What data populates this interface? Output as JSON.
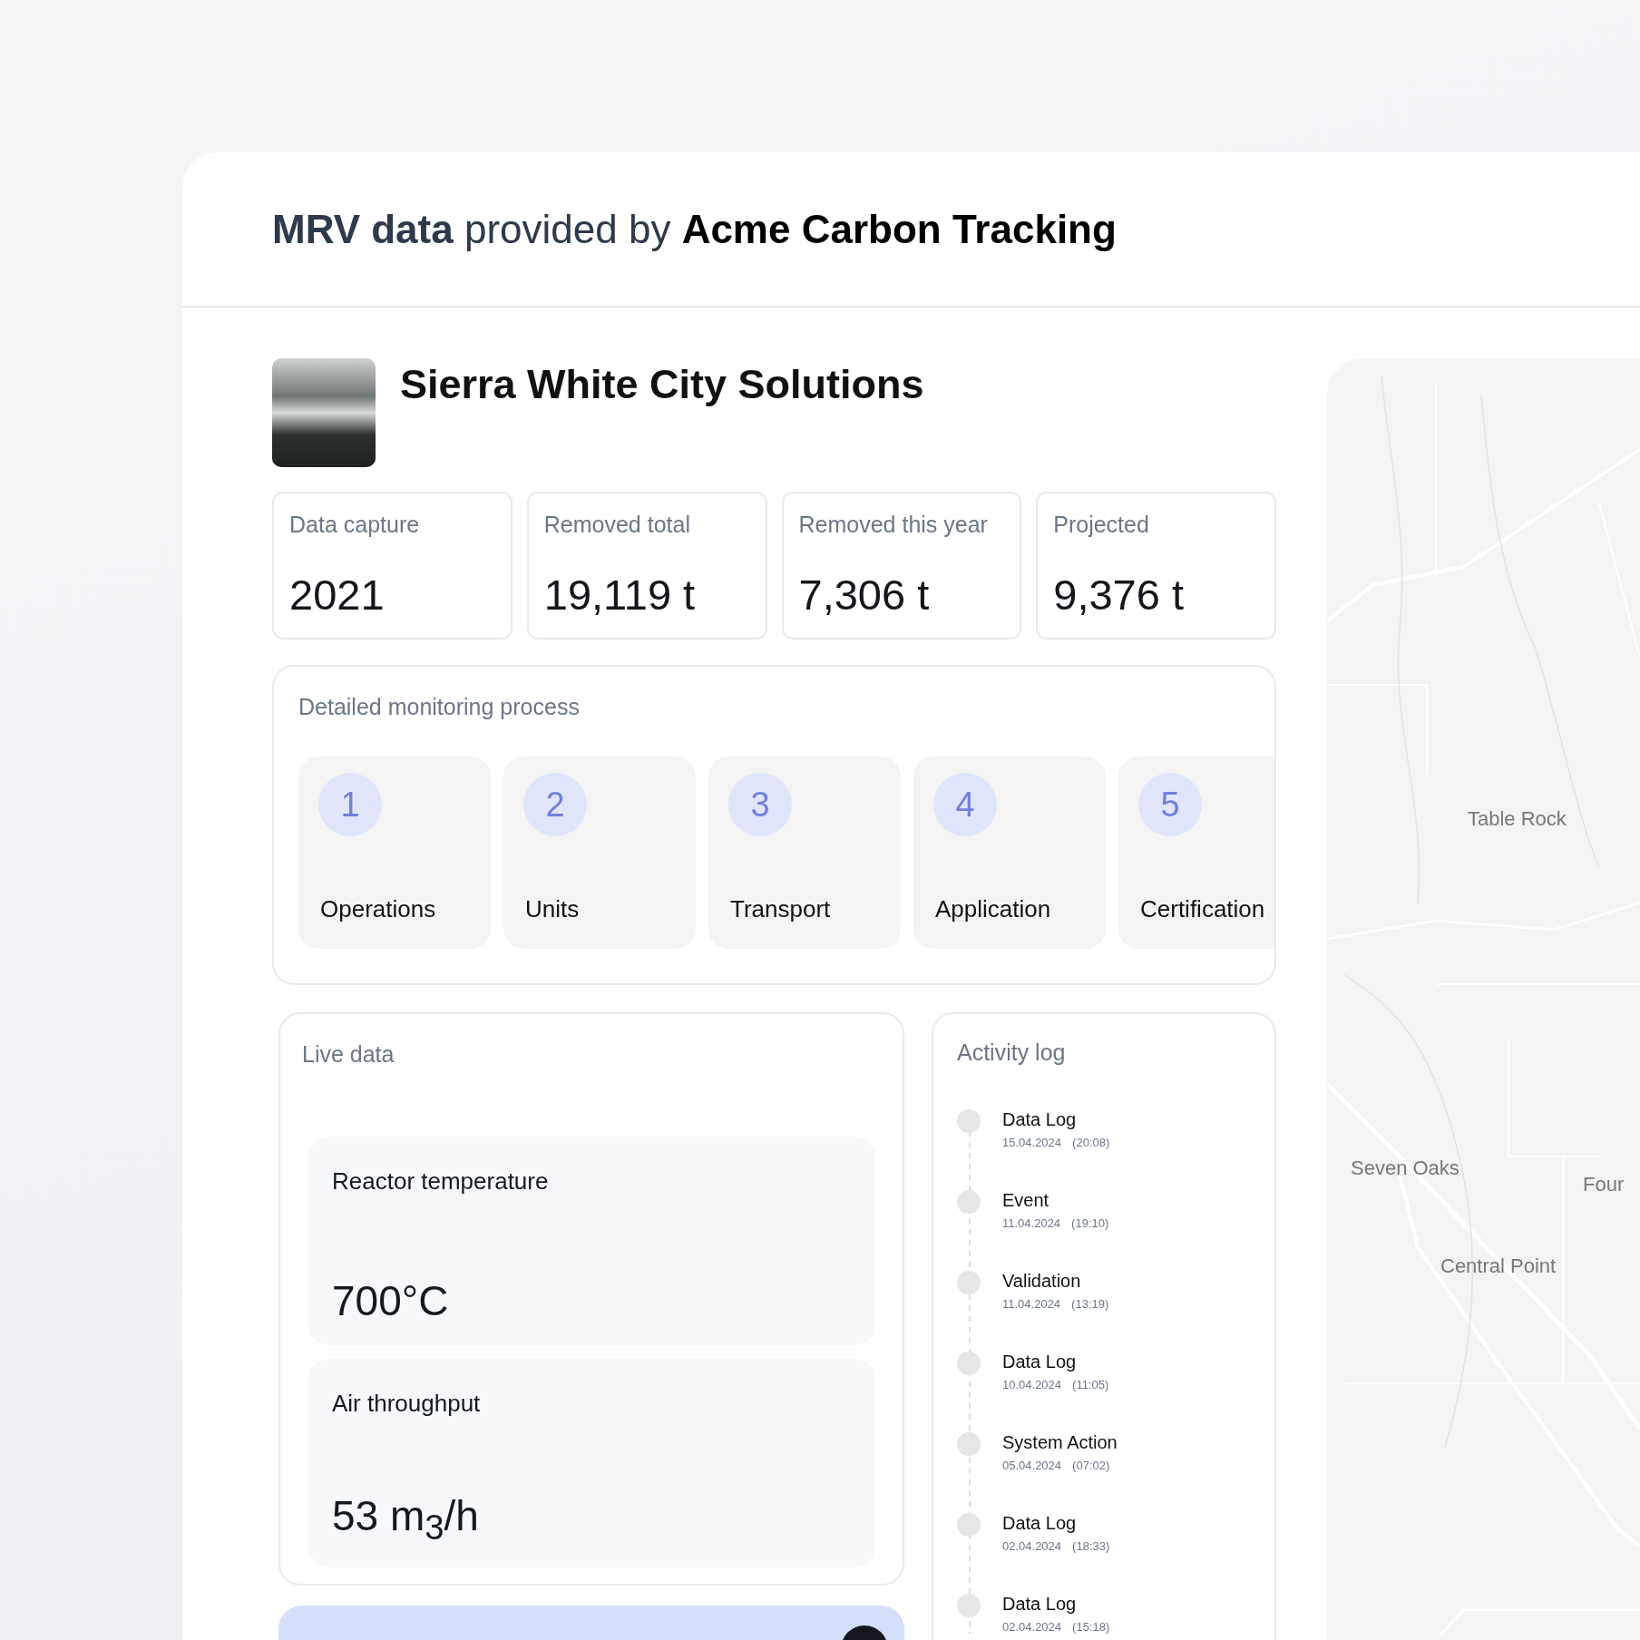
{
  "header": {
    "title": "**MRV data** provided by **Acme Carbon Tracking**"
  },
  "project": {
    "name": "Sierra White City Solutions"
  },
  "stats": [
    {
      "label": "Data capture",
      "value": "2021"
    },
    {
      "label": "Removed total",
      "value": "19,119 t"
    },
    {
      "label": "Removed this year",
      "value": "7,306 t"
    },
    {
      "label": "Projected",
      "value": "9,376 t"
    }
  ],
  "monitoring": {
    "title": "Detailed monitoring process",
    "steps": [
      {
        "number": "1",
        "label": "Operations"
      },
      {
        "number": "2",
        "label": "Units"
      },
      {
        "number": "3",
        "label": "Transport"
      },
      {
        "number": "4",
        "label": "Application"
      },
      {
        "number": "5",
        "label": "Certification"
      }
    ]
  },
  "live_data": {
    "title": "Live data",
    "readings": [
      {
        "label": "Reactor temperature",
        "value": "700°C"
      },
      {
        "label": "Air throughput",
        "value": "53 m$_{3}$/h"
      }
    ]
  },
  "activity_log": {
    "title": "Activity log",
    "entries": [
      {
        "title": "Data Log",
        "date": "15.04.2024",
        "time": "(20:08)"
      },
      {
        "title": "Event",
        "date": "11.04.2024",
        "time": "(19:10)"
      },
      {
        "title": "Validation",
        "date": "11.04.2024",
        "time": "(13:19)"
      },
      {
        "title": "Data Log",
        "date": "10.04.2024",
        "time": "(11:05)"
      },
      {
        "title": "System Action",
        "date": "05.04.2024",
        "time": "(07:02)"
      },
      {
        "title": "Data Log",
        "date": "02.04.2024",
        "time": "(18:33)"
      },
      {
        "title": "Data Log",
        "date": "02.04.2024",
        "time": "(15:18)"
      }
    ]
  },
  "map": {
    "labels": [
      "Table Rock",
      "Seven Oaks",
      "Four",
      "Central Point"
    ]
  }
}
